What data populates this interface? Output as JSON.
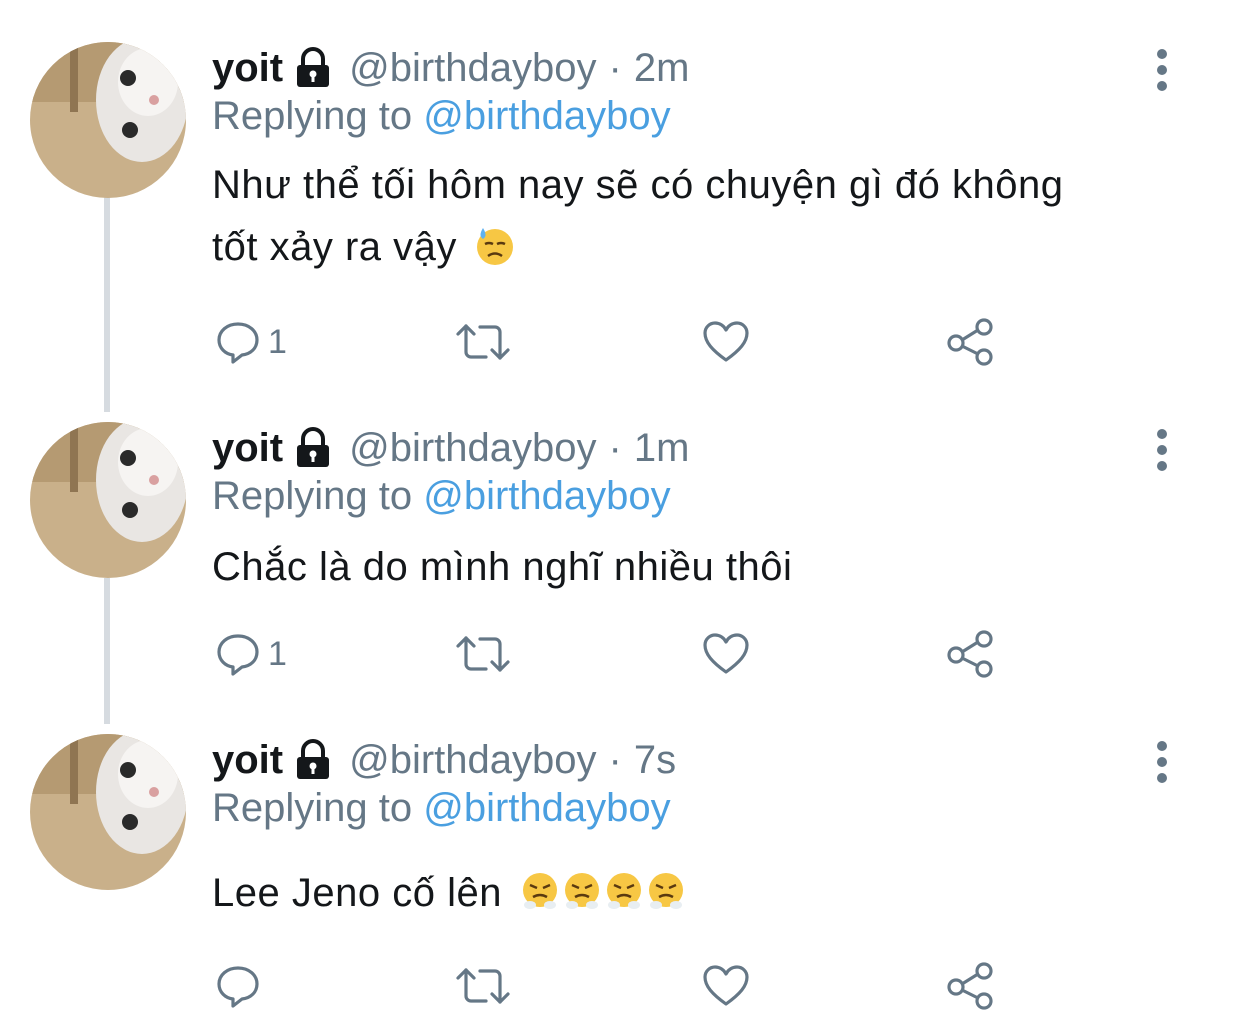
{
  "tweets": [
    {
      "name": "yoit",
      "handle": "@birthdayboy",
      "separator": "·",
      "time": "2m",
      "replying_prefix": "Replying to",
      "replying_mention": "@birthdayboy",
      "text_line1": "Như thể tối hôm nay sẽ có chuyện gì đó không",
      "text_line2": "tốt xảy ra vậy",
      "emoji": "downcast-face-with-sweat",
      "reply_count": "1"
    },
    {
      "name": "yoit",
      "handle": "@birthdayboy",
      "separator": "·",
      "time": "1m",
      "replying_prefix": "Replying to",
      "replying_mention": "@birthdayboy",
      "text_line1": "Chắc là do mình nghĩ nhiều thôi",
      "reply_count": "1"
    },
    {
      "name": "yoit",
      "handle": "@birthdayboy",
      "separator": "·",
      "time": "7s",
      "replying_prefix": "Replying to",
      "replying_mention": "@birthdayboy",
      "text_line1": "Lee Jeno cố lên",
      "emoji": "face-with-steam-from-nose x4",
      "reply_count": ""
    }
  ],
  "icons": {
    "lock": "lock-icon",
    "more": "more-vertical-icon",
    "reply": "reply-icon",
    "retweet": "retweet-icon",
    "like": "heart-icon",
    "share": "share-icon"
  },
  "colors": {
    "text": "#14171a",
    "secondary": "#657786",
    "mention": "#4a9fe0",
    "thread_line": "#d6dbe0"
  }
}
